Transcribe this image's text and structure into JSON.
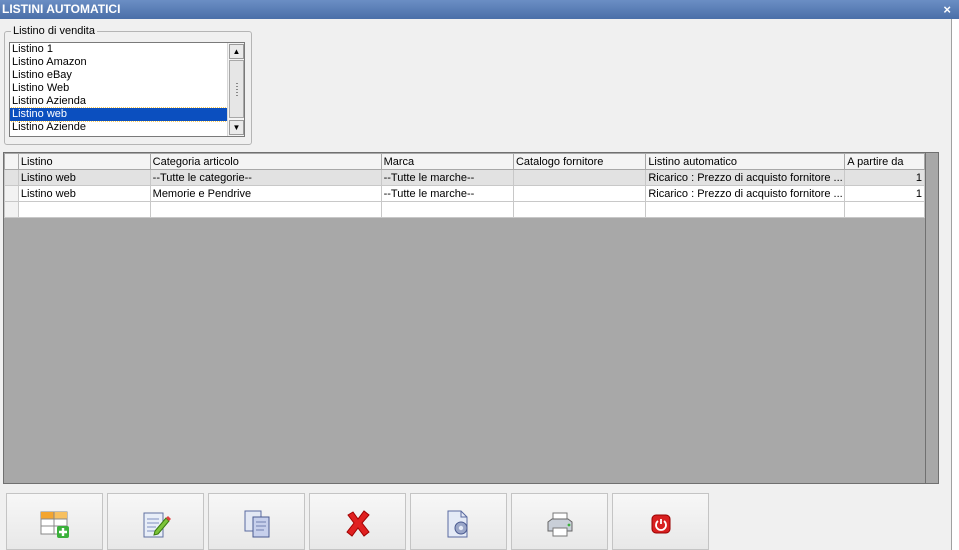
{
  "window": {
    "title": "LISTINI AUTOMATICI",
    "close_label": "×"
  },
  "listino_vendita": {
    "legend": "Listino di vendita",
    "items": [
      {
        "label": "Listino 1",
        "selected": false
      },
      {
        "label": "Listino Amazon",
        "selected": false
      },
      {
        "label": "Listino eBay",
        "selected": false
      },
      {
        "label": "Listino Web",
        "selected": false
      },
      {
        "label": "Listino Azienda",
        "selected": false
      },
      {
        "label": "Listino web",
        "selected": true
      },
      {
        "label": "Listino Aziende",
        "selected": false
      }
    ],
    "scroll_up": "▲",
    "scroll_down": "▼"
  },
  "grid": {
    "columns": [
      "Listino",
      "Categoria articolo",
      "Marca",
      "Catalogo fornitore",
      "Listino automatico",
      "A partire da"
    ],
    "rows": [
      [
        "Listino web",
        "--Tutte le categorie--",
        "--Tutte le marche--",
        "",
        "Ricarico : Prezzo di acquisto fornitore ...",
        "1"
      ],
      [
        "Listino web",
        "Memorie e Pendrive",
        "--Tutte le marche--",
        "",
        "Ricarico : Prezzo di acquisto fornitore ...",
        "1"
      ],
      [
        "",
        "",
        "",
        "",
        "",
        ""
      ]
    ]
  },
  "toolbar": {
    "buttons": [
      {
        "name": "add-row-button",
        "icon": "table-add-icon"
      },
      {
        "name": "edit-button",
        "icon": "edit-pencil-icon"
      },
      {
        "name": "copy-button",
        "icon": "copy-documents-icon"
      },
      {
        "name": "delete-button",
        "icon": "red-x-icon"
      },
      {
        "name": "settings-button",
        "icon": "document-gear-icon"
      },
      {
        "name": "print-button",
        "icon": "printer-icon"
      },
      {
        "name": "exit-button",
        "icon": "power-icon"
      }
    ]
  },
  "colors": {
    "title_bar": "#4a6fa8",
    "selection": "#0b4fbf",
    "grid_bg": "#a8a8a8",
    "delete_red": "#e02020",
    "power_red": "#d82020"
  }
}
